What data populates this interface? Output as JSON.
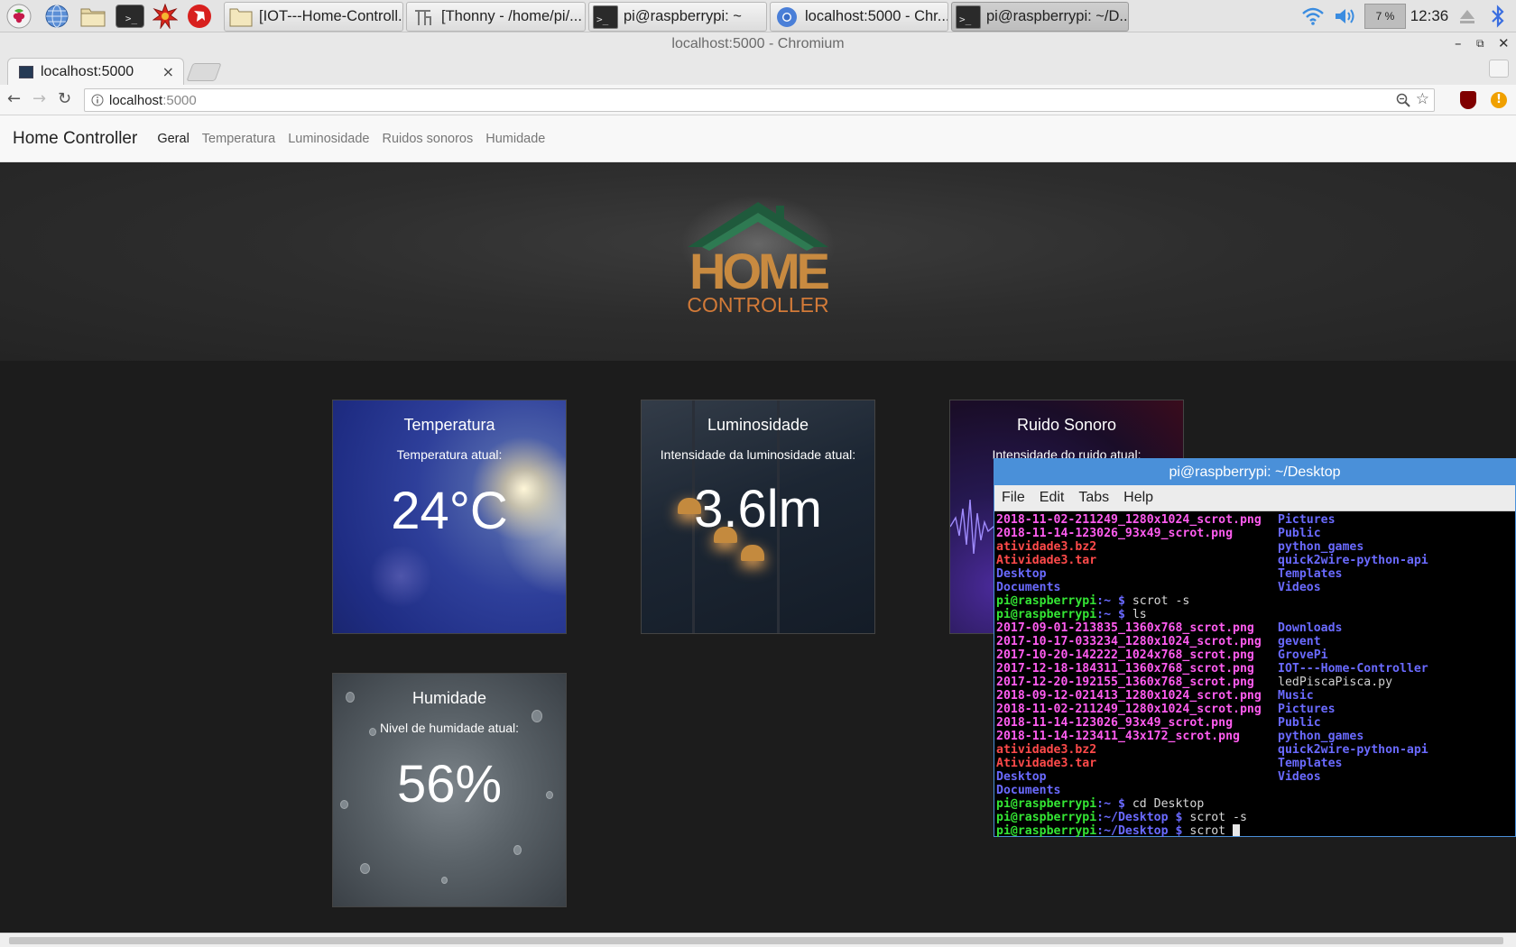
{
  "taskbar": {
    "tasks": [
      {
        "label": "[IOT---Home-Controll..."
      },
      {
        "label": "[Thonny  -  /home/pi/..."
      },
      {
        "label": "pi@raspberrypi: ~"
      },
      {
        "label": "localhost:5000 - Chr..."
      },
      {
        "label": "pi@raspberrypi: ~/D..."
      }
    ],
    "cpu": "7 %",
    "clock": "12:36"
  },
  "browser": {
    "window_title": "localhost:5000 - Chromium",
    "tab_title": "localhost:5000",
    "tab_close": "×",
    "url_host": "localhost",
    "url_port": ":5000"
  },
  "page": {
    "brand": "Home Controller",
    "nav": [
      "Geral",
      "Temperatura",
      "Luminosidade",
      "Ruidos sonoros",
      "Humidade"
    ],
    "active_nav": "Geral",
    "logo": {
      "line1": "HOME",
      "line2": "CONTROLLER"
    },
    "cards": {
      "temp": {
        "title": "Temperatura",
        "label": "Temperatura atual:",
        "value": "24°C"
      },
      "lum": {
        "title": "Luminosidade",
        "label": "Intensidade da luminosidade atual:",
        "value": "3.6lm"
      },
      "noise": {
        "title": "Ruido Sonoro",
        "label": "Intensidade do ruido atual:"
      },
      "hum": {
        "title": "Humidade",
        "label": "Nivel de humidade atual:",
        "value": "56%"
      }
    }
  },
  "terminal": {
    "title": "pi@raspberrypi: ~/Desktop",
    "menu": [
      "File",
      "Edit",
      "Tabs",
      "Help"
    ],
    "lines": [
      [
        {
          "t": "2018-11-02-211249_1280x1024_scrot.png",
          "c": "c-img"
        },
        {
          "t": "Pictures",
          "c": "c-dir"
        }
      ],
      [
        {
          "t": "2018-11-14-123026_93x49_scrot.png",
          "c": "c-img"
        },
        {
          "t": "Public",
          "c": "c-dir"
        }
      ],
      [
        {
          "t": "atividade3.bz2",
          "c": "c-arc"
        },
        {
          "t": "python_games",
          "c": "c-dir"
        }
      ],
      [
        {
          "t": "Atividade3.tar",
          "c": "c-arc"
        },
        {
          "t": "quick2wire-python-api",
          "c": "c-dir"
        }
      ],
      [
        {
          "t": "Desktop",
          "c": "c-dir"
        },
        {
          "t": "Templates",
          "c": "c-dir"
        }
      ],
      [
        {
          "t": "Documents",
          "c": "c-dir"
        },
        {
          "t": "Videos",
          "c": "c-dir"
        }
      ],
      {
        "prompt": "pi@raspberrypi",
        "path": ":~ $ ",
        "cmd": "scrot -s"
      },
      {
        "prompt": "pi@raspberrypi",
        "path": ":~ $ ",
        "cmd": "ls"
      },
      [
        {
          "t": "2017-09-01-213835_1360x768_scrot.png",
          "c": "c-img"
        },
        {
          "t": "Downloads",
          "c": "c-dir"
        }
      ],
      [
        {
          "t": "2017-10-17-033234_1280x1024_scrot.png",
          "c": "c-img"
        },
        {
          "t": "gevent",
          "c": "c-dir"
        }
      ],
      [
        {
          "t": "2017-10-20-142222_1024x768_scrot.png",
          "c": "c-img"
        },
        {
          "t": "GrovePi",
          "c": "c-dir"
        }
      ],
      [
        {
          "t": "2017-12-18-184311_1360x768_scrot.png",
          "c": "c-img"
        },
        {
          "t": "IOT---Home-Controller",
          "c": "c-dir"
        }
      ],
      [
        {
          "t": "2017-12-20-192155_1360x768_scrot.png",
          "c": "c-img"
        },
        {
          "t": "ledPiscaPisca.py",
          "c": "c-file"
        }
      ],
      [
        {
          "t": "2018-09-12-021413_1280x1024_scrot.png",
          "c": "c-img"
        },
        {
          "t": "Music",
          "c": "c-dir"
        }
      ],
      [
        {
          "t": "2018-11-02-211249_1280x1024_scrot.png",
          "c": "c-img"
        },
        {
          "t": "Pictures",
          "c": "c-dir"
        }
      ],
      [
        {
          "t": "2018-11-14-123026_93x49_scrot.png",
          "c": "c-img"
        },
        {
          "t": "Public",
          "c": "c-dir"
        }
      ],
      [
        {
          "t": "2018-11-14-123411_43x172_scrot.png",
          "c": "c-img"
        },
        {
          "t": "python_games",
          "c": "c-dir"
        }
      ],
      [
        {
          "t": "atividade3.bz2",
          "c": "c-arc"
        },
        {
          "t": "quick2wire-python-api",
          "c": "c-dir"
        }
      ],
      [
        {
          "t": "Atividade3.tar",
          "c": "c-arc"
        },
        {
          "t": "Templates",
          "c": "c-dir"
        }
      ],
      [
        {
          "t": "Desktop",
          "c": "c-dir"
        },
        {
          "t": "Videos",
          "c": "c-dir"
        }
      ],
      [
        {
          "t": "Documents",
          "c": "c-dir"
        }
      ],
      {
        "prompt": "pi@raspberrypi",
        "path": ":~ $ ",
        "cmd": "cd Desktop"
      },
      {
        "prompt": "pi@raspberrypi",
        "path": ":~/Desktop $ ",
        "cmd": "scrot -s"
      },
      {
        "prompt": "pi@raspberrypi",
        "path": ":~/Desktop $ ",
        "cmd": "scrot ",
        "cursor": true
      }
    ]
  },
  "colors": {
    "taskbar_bg": "#e4e4e4",
    "terminal_titlebar": "#4a90d9",
    "page_bg": "#1c1c1c",
    "prompt_user": "#34e634",
    "prompt_path": "#6a6aff",
    "image_file": "#ff5cf0",
    "archive_file": "#ff4a4a"
  },
  "icons": [
    "raspberry-icon",
    "globe-icon",
    "folder-icon",
    "terminal-icon",
    "burst-icon",
    "wolfram-icon",
    "wifi-icon",
    "volume-icon",
    "bluetooth-icon",
    "eject-icon"
  ]
}
